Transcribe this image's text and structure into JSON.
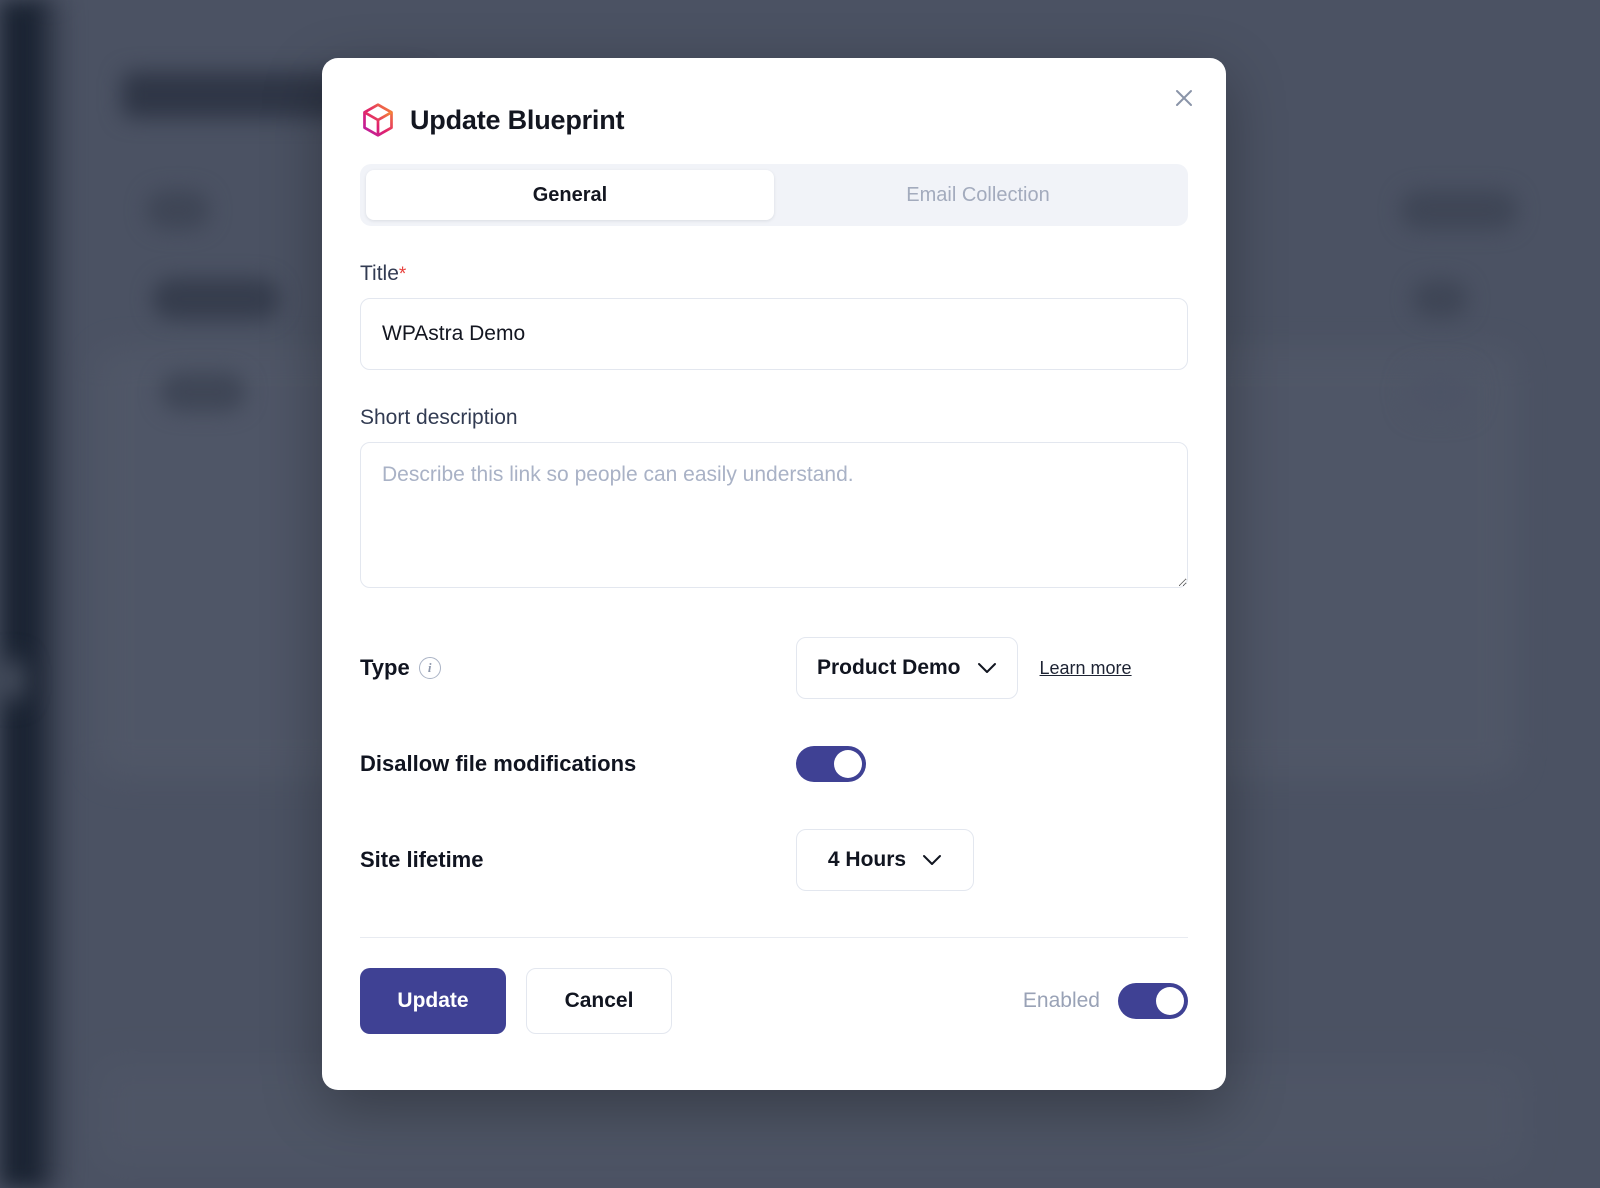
{
  "modal": {
    "icon_name": "cube-logo-icon",
    "title": "Update Blueprint",
    "close_label": "✕",
    "tabs": [
      {
        "label": "General",
        "active": true
      },
      {
        "label": "Email Collection",
        "active": false
      }
    ],
    "fields": {
      "title": {
        "label": "Title",
        "required_marker": "*",
        "value": "WPAstra Demo",
        "placeholder": ""
      },
      "short_description": {
        "label": "Short description",
        "value": "",
        "placeholder": "Describe this link so people can easily understand."
      },
      "type": {
        "label": "Type",
        "info_icon": "info-icon",
        "value": "Product Demo",
        "link_label": "Learn more"
      },
      "disallow_file_modifications": {
        "label": "Disallow file modifications",
        "state": "on"
      },
      "site_lifetime": {
        "label": "Site lifetime",
        "value": "4 Hours"
      }
    },
    "footer": {
      "primary_label": "Update",
      "secondary_label": "Cancel",
      "enabled_label": "Enabled",
      "enabled_state": "on"
    }
  },
  "colors": {
    "accent": "#3f4194",
    "overlay": "#4b5263",
    "required": "#e8413c",
    "tab_bg": "#f1f3f8",
    "muted_text": "#99a2b6"
  }
}
